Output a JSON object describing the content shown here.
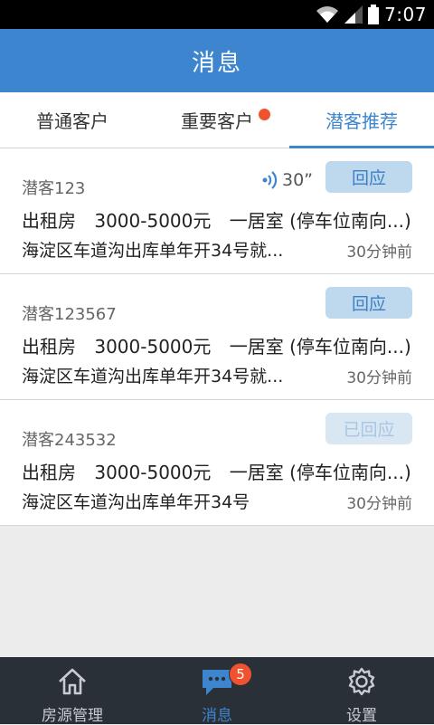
{
  "status_bar": {
    "time": "7:07"
  },
  "header": {
    "title": "消息"
  },
  "tabs": [
    {
      "label": "普通客户",
      "active": false,
      "dot": false
    },
    {
      "label": "重要客户",
      "active": false,
      "dot": true
    },
    {
      "label": "潜客推荐",
      "active": true,
      "dot": false
    }
  ],
  "messages": [
    {
      "name": "潜客123",
      "voice": "30”",
      "reply_label": "回应",
      "type": "出租房",
      "price": "3000-5000元",
      "layout": "一居室 (停车位南向...)",
      "address": "海淀区车道沟出库单年开34号就...",
      "ago": "30分钟前"
    },
    {
      "name": "潜客123567",
      "reply_label": "回应",
      "type": "出租房",
      "price": "3000-5000元",
      "layout": "一居室 (停车位南向...)",
      "address": "海淀区车道沟出库单年开34号就...",
      "ago": "30分钟前"
    },
    {
      "name": "潜客243532",
      "reply_label": "已回应",
      "type": "出租房",
      "price": "3000-5000元",
      "layout": "一居室 (停车位南向...)",
      "address": "海淀区车道沟出库单年开34号",
      "ago": "30分钟前"
    }
  ],
  "bottom_nav": [
    {
      "label": "房源管理",
      "icon": "home-icon"
    },
    {
      "label": "消息",
      "icon": "message-icon",
      "badge": "5"
    },
    {
      "label": "设置",
      "icon": "gear-icon"
    }
  ],
  "colors": {
    "primary": "#3d86cf",
    "badge": "#f0522d",
    "nav_bg": "#2a3038"
  }
}
